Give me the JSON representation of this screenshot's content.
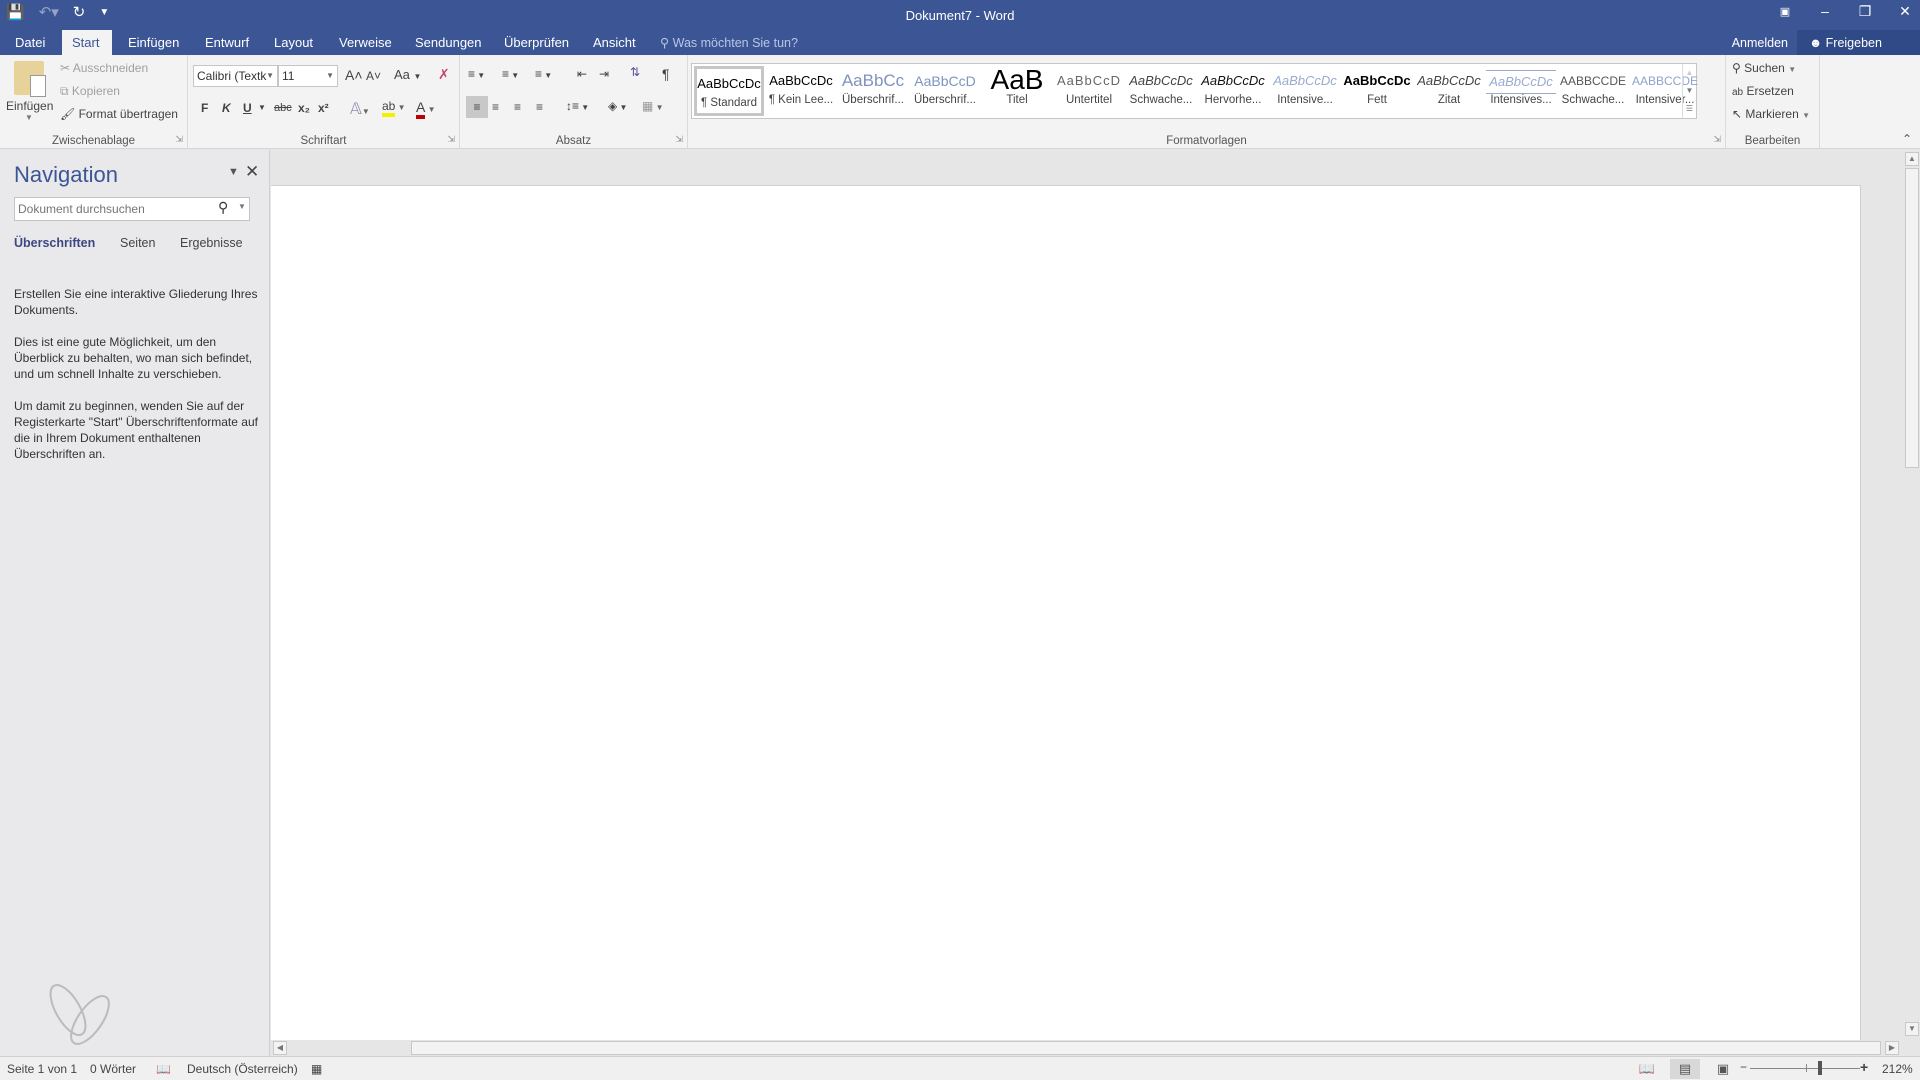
{
  "window": {
    "title": "Dokument7 - Word",
    "controls": {
      "ribbon_display": "ribbon-display-icon",
      "minimize": "minimize-icon",
      "restore": "restore-icon",
      "close": "close-icon"
    }
  },
  "qat": {
    "save": "save-icon",
    "undo": "undo-icon",
    "redo": "repeat-icon",
    "customize": "customize-qat-icon"
  },
  "tabs": [
    {
      "label": "Datei"
    },
    {
      "label": "Start",
      "active": true
    },
    {
      "label": "Einfügen"
    },
    {
      "label": "Entwurf"
    },
    {
      "label": "Layout"
    },
    {
      "label": "Verweise"
    },
    {
      "label": "Sendungen"
    },
    {
      "label": "Überprüfen"
    },
    {
      "label": "Ansicht"
    }
  ],
  "tell_me": "Was möchten Sie tun?",
  "account": {
    "sign_in": "Anmelden",
    "share": "Freigeben"
  },
  "ribbon": {
    "clipboard": {
      "label": "Zwischenablage",
      "paste": "Einfügen",
      "cut": "Ausschneiden",
      "copy": "Kopieren",
      "format_painter": "Format übertragen"
    },
    "font": {
      "label": "Schriftart",
      "font_name": "Calibri (Textk",
      "font_size": "11",
      "bold": "F",
      "italic": "K",
      "underline": "U",
      "strike": "abc",
      "subscript": "x₂",
      "superscript": "x²",
      "grow": "A˄",
      "shrink": "A˅",
      "change_case": "Aa",
      "highlight_color": "#f2f200",
      "font_color": "#c00000"
    },
    "paragraph": {
      "label": "Absatz"
    },
    "styles": {
      "label": "Formatvorlagen",
      "items": [
        {
          "preview": "AaBbCcDc",
          "name": "¶ Standard",
          "selected": true
        },
        {
          "preview": "AaBbCcDc",
          "name": "¶ Kein Lee..."
        },
        {
          "preview": "AaBbCc",
          "name": "Überschrif..."
        },
        {
          "preview": "AaBbCcD",
          "name": "Überschrif..."
        },
        {
          "preview": "AaB",
          "name": "Titel"
        },
        {
          "preview": "AaBbCcD",
          "name": "Untertitel"
        },
        {
          "preview": "AaBbCcDc",
          "name": "Schwache..."
        },
        {
          "preview": "AaBbCcDc",
          "name": "Hervorhe..."
        },
        {
          "preview": "AaBbCcDc",
          "name": "Intensive..."
        },
        {
          "preview": "AaBbCcDc",
          "name": "Fett"
        },
        {
          "preview": "AaBbCcDc",
          "name": "Zitat"
        },
        {
          "preview": "AaBbCcDc",
          "name": "Intensives..."
        },
        {
          "preview": "AABBCCDE",
          "name": "Schwache..."
        },
        {
          "preview": "AABBCCDE",
          "name": "Intensiver..."
        }
      ]
    },
    "editing": {
      "label": "Bearbeiten",
      "find": "Suchen",
      "replace": "Ersetzen",
      "select": "Markieren"
    }
  },
  "navigation": {
    "title": "Navigation",
    "search_placeholder": "Dokument durchsuchen",
    "tabs": [
      {
        "label": "Überschriften",
        "active": true
      },
      {
        "label": "Seiten"
      },
      {
        "label": "Ergebnisse"
      }
    ],
    "paragraphs": [
      "Erstellen Sie eine interaktive Gliederung Ihres Dokuments.",
      "Dies ist eine gute Möglichkeit, um den Überblick zu behalten, wo man sich befindet, und um schnell Inhalte zu verschieben.",
      "Um damit zu beginnen, wenden Sie auf der Registerkarte \"Start\" Überschriftenformate auf die in Ihrem Dokument enthaltenen Überschriften an."
    ]
  },
  "status": {
    "page": "Seite 1 von 1",
    "words": "0 Wörter",
    "language": "Deutsch (Österreich)",
    "zoom": "212%",
    "zoom_percent": 212,
    "active_view": "print-layout"
  }
}
